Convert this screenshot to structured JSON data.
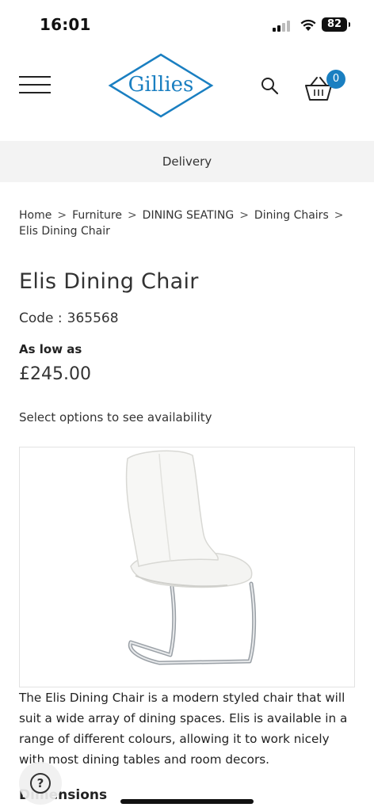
{
  "status_bar": {
    "time": "16:01",
    "battery_level": "82",
    "icons": [
      "signal-icon",
      "wifi-icon",
      "battery-icon"
    ]
  },
  "header": {
    "logo_text": "Gillies",
    "basket_count": "0",
    "brand_color": "#1a7fc1",
    "icons": [
      "menu-icon",
      "search-icon",
      "basket-icon"
    ]
  },
  "delivery_bar": {
    "label": "Delivery"
  },
  "breadcrumb": {
    "items": [
      "Home",
      "Furniture",
      "DINING SEATING",
      "Dining Chairs",
      "Elis Dining Chair"
    ],
    "separator": ">"
  },
  "product": {
    "title": "Elis Dining Chair",
    "code_label": "Code :",
    "code_value": "365568",
    "price_label": "As low as",
    "price": "£245.00",
    "availability": "Select options to see availability",
    "description": "The Elis Dining Chair is a modern styled chair that will suit a wide array of dining spaces. Elis is available in a range of different colours, allowing it to work nicely with most dining tables and room decors.",
    "dimensions_heading": "Dimensions"
  },
  "help": {
    "label": "?"
  }
}
